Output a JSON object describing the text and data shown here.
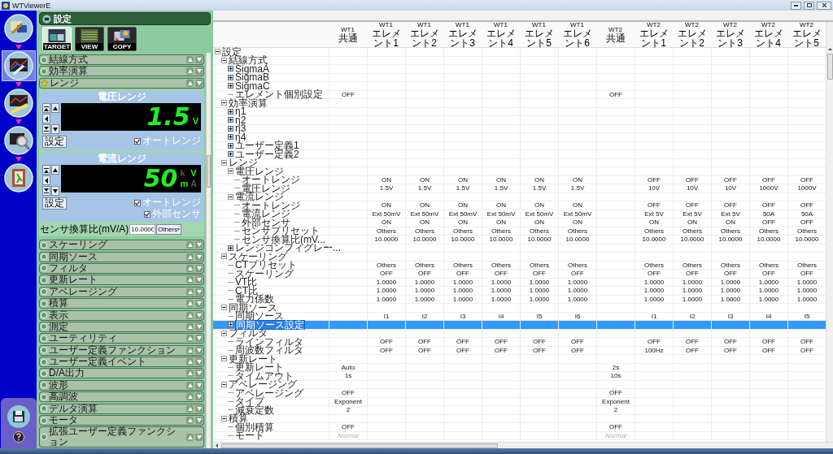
{
  "window": {
    "title": "WTViewerE"
  },
  "rail": {
    "items": [
      {
        "kind": "tools",
        "selected": false
      },
      {
        "kind": "wrench-chart",
        "selected": true
      },
      {
        "kind": "ruler-chart",
        "selected": false
      },
      {
        "kind": "magnifier",
        "selected": false
      },
      {
        "kind": "exit",
        "selected": false
      }
    ],
    "bottom": [
      {
        "kind": "save"
      },
      {
        "kind": "help"
      }
    ]
  },
  "left_panel": {
    "title": "設定",
    "toolbar": [
      {
        "label": "TARGET",
        "kind": "target",
        "selected": true
      },
      {
        "label": "VIEW",
        "kind": "view",
        "selected": false
      },
      {
        "label": "COPY",
        "kind": "copy",
        "selected": false
      }
    ],
    "sections": [
      {
        "label": "結線方式",
        "expanded": false
      },
      {
        "label": "効率演算",
        "expanded": false
      },
      {
        "label": "レンジ",
        "expanded": true,
        "panels": [
          {
            "title": "電圧レンジ",
            "display": "1.5",
            "units": [
              {
                "text": "V",
                "lit": true
              }
            ],
            "button": "設定",
            "checks": [
              {
                "label": "オートレンジ",
                "checked": true
              }
            ]
          },
          {
            "title": "電流レンジ",
            "display": "50",
            "units": [
              {
                "text": "k",
                "lit": false
              },
              {
                "text": "V",
                "lit": true
              },
              {
                "text": "m",
                "lit": true
              },
              {
                "text": "A",
                "lit": false
              }
            ],
            "button": "設定",
            "checks": [
              {
                "label": "オートレンジ",
                "checked": true
              },
              {
                "label": "外部センサ",
                "checked": true
              }
            ]
          }
        ],
        "sensor": {
          "label": "センサ換算比(mV/A)",
          "value": "10.0000",
          "preset": "Others"
        }
      },
      {
        "label": "スケーリング",
        "expanded": false
      },
      {
        "label": "同期ソース",
        "expanded": false
      },
      {
        "label": "フィルタ",
        "expanded": false
      },
      {
        "label": "更新レート",
        "expanded": false
      },
      {
        "label": "アベレージング",
        "expanded": false
      },
      {
        "label": "積算",
        "expanded": false
      },
      {
        "label": "表示",
        "expanded": false
      },
      {
        "label": "測定",
        "expanded": false
      },
      {
        "label": "ユーティリティ",
        "expanded": false
      },
      {
        "label": "ユーザー定義ファンクション",
        "expanded": false
      },
      {
        "label": "ユーザー定義イベント",
        "expanded": false
      },
      {
        "label": "D/A出力",
        "expanded": false
      },
      {
        "label": "波形",
        "expanded": false
      },
      {
        "label": "高調波",
        "expanded": false
      },
      {
        "label": "デルタ演算",
        "expanded": false
      },
      {
        "label": "モータ",
        "expanded": false
      },
      {
        "label": "拡張ユーザー定義ファンクション",
        "expanded": false
      }
    ]
  },
  "table": {
    "columns": [
      {
        "unit": "WT1",
        "name": "共通"
      },
      {
        "unit": "WT1",
        "name": "エレメント1"
      },
      {
        "unit": "WT1",
        "name": "エレメント2"
      },
      {
        "unit": "WT1",
        "name": "エレメント3"
      },
      {
        "unit": "WT1",
        "name": "エレメント4"
      },
      {
        "unit": "WT1",
        "name": "エレメント5"
      },
      {
        "unit": "WT1",
        "name": "エレメント6"
      },
      {
        "unit": "WT2",
        "name": "共通"
      },
      {
        "unit": "WT2",
        "name": "エレメント1"
      },
      {
        "unit": "WT2",
        "name": "エレメント2"
      },
      {
        "unit": "WT2",
        "name": "エレメント3"
      },
      {
        "unit": "WT2",
        "name": "エレメント4"
      },
      {
        "unit": "WT2",
        "name": "エレメント5"
      }
    ],
    "tree": [
      {
        "label": "設定",
        "kind": "folder",
        "expanded": true,
        "selected": false,
        "children": [
          {
            "label": "結線方式",
            "kind": "folder",
            "expanded": true,
            "selected": false,
            "children": [
              {
                "label": "SigmaA",
                "kind": "folder",
                "expanded": false,
                "selected": false
              },
              {
                "label": "SigmaB",
                "kind": "folder",
                "expanded": false,
                "selected": false
              },
              {
                "label": "SigmaC",
                "kind": "folder",
                "expanded": false,
                "selected": false
              },
              {
                "label": "エレメント個別設定",
                "kind": "leaf",
                "selected": false,
                "disabled": false,
                "cells": [
                  "OFF",
                  null,
                  null,
                  null,
                  null,
                  null,
                  null,
                  "OFF",
                  null,
                  null,
                  null,
                  null,
                  null
                ]
              }
            ]
          },
          {
            "label": "効率演算",
            "kind": "folder",
            "expanded": true,
            "selected": false,
            "children": [
              {
                "label": "η1",
                "kind": "folder",
                "expanded": false,
                "selected": false
              },
              {
                "label": "η2",
                "kind": "folder",
                "expanded": false,
                "selected": false
              },
              {
                "label": "η3",
                "kind": "folder",
                "expanded": false,
                "selected": false
              },
              {
                "label": "η4",
                "kind": "folder",
                "expanded": false,
                "selected": false
              },
              {
                "label": "ユーザー定義1",
                "kind": "folder",
                "expanded": false,
                "selected": false
              },
              {
                "label": "ユーザー定義2",
                "kind": "folder",
                "expanded": false,
                "selected": false
              }
            ]
          },
          {
            "label": "レンジ",
            "kind": "folder",
            "expanded": true,
            "selected": false,
            "children": [
              {
                "label": "電圧レンジ",
                "kind": "folder",
                "expanded": true,
                "selected": false,
                "children": [
                  {
                    "label": "オートレンジ",
                    "kind": "leaf",
                    "selected": false,
                    "disabled": false,
                    "cells": [
                      null,
                      "ON",
                      "ON",
                      "ON",
                      "ON",
                      "ON",
                      "ON",
                      null,
                      "OFF",
                      "OFF",
                      "OFF",
                      "OFF",
                      "OFF"
                    ]
                  },
                  {
                    "label": "電圧レンジ",
                    "kind": "leaf",
                    "selected": false,
                    "disabled": false,
                    "cells": [
                      null,
                      "1.5V",
                      "1.5V",
                      "1.5V",
                      "1.5V",
                      "1.5V",
                      "1.5V",
                      null,
                      "10V",
                      "10V",
                      "10V",
                      "1000V",
                      "1000V"
                    ]
                  }
                ]
              },
              {
                "label": "電流レンジ",
                "kind": "folder",
                "expanded": true,
                "selected": false,
                "children": [
                  {
                    "label": "オートレンジ",
                    "kind": "leaf",
                    "selected": false,
                    "disabled": false,
                    "cells": [
                      null,
                      "ON",
                      "ON",
                      "ON",
                      "ON",
                      "ON",
                      "ON",
                      null,
                      "OFF",
                      "OFF",
                      "OFF",
                      "OFF",
                      "OFF"
                    ]
                  },
                  {
                    "label": "電流レンジ",
                    "kind": "leaf",
                    "selected": false,
                    "disabled": false,
                    "cells": [
                      null,
                      "Ext 50mV",
                      "Ext 50mV",
                      "Ext 50mV",
                      "Ext 50mV",
                      "Ext 50mV",
                      "Ext 50mV",
                      null,
                      "Ext 5V",
                      "Ext 5V",
                      "Ext 5V",
                      "50A",
                      "50A"
                    ]
                  },
                  {
                    "label": "外部センサ",
                    "kind": "leaf",
                    "selected": false,
                    "disabled": false,
                    "cells": [
                      null,
                      "ON",
                      "ON",
                      "ON",
                      "ON",
                      "ON",
                      "ON",
                      null,
                      "ON",
                      "ON",
                      "ON",
                      "OFF",
                      "OFF"
                    ]
                  },
                  {
                    "label": "センサプリセット",
                    "kind": "leaf",
                    "selected": false,
                    "disabled": false,
                    "cells": [
                      null,
                      "Others",
                      "Others",
                      "Others",
                      "Others",
                      "Others",
                      "Others",
                      null,
                      "Others",
                      "Others",
                      "Others",
                      "Others",
                      "Others"
                    ]
                  },
                  {
                    "label": "センサ換算比(mV...",
                    "kind": "leaf",
                    "selected": false,
                    "disabled": false,
                    "cells": [
                      null,
                      "10.0000",
                      "10.0000",
                      "10.0000",
                      "10.0000",
                      "10.0000",
                      "10.0000",
                      null,
                      "10.0000",
                      "10.0000",
                      "10.0000",
                      "10.0000",
                      "10.0000"
                    ]
                  }
                ]
              },
              {
                "label": "レンジコンフィグレー...",
                "kind": "folder",
                "expanded": false,
                "selected": false
              }
            ]
          },
          {
            "label": "スケーリング",
            "kind": "folder",
            "expanded": true,
            "selected": false,
            "children": [
              {
                "label": "CTプリセット",
                "kind": "leaf",
                "selected": false,
                "disabled": false,
                "cells": [
                  null,
                  "Others",
                  "Others",
                  "Others",
                  "Others",
                  "Others",
                  "Others",
                  null,
                  "Others",
                  "Others",
                  "Others",
                  "Others",
                  "Others"
                ]
              },
              {
                "label": "スケーリング",
                "kind": "leaf",
                "selected": false,
                "disabled": false,
                "cells": [
                  null,
                  "OFF",
                  "OFF",
                  "OFF",
                  "OFF",
                  "OFF",
                  "OFF",
                  null,
                  "OFF",
                  "OFF",
                  "OFF",
                  "OFF",
                  "OFF"
                ]
              },
              {
                "label": "VT比",
                "kind": "leaf",
                "selected": false,
                "disabled": false,
                "cells": [
                  null,
                  "1.0000",
                  "1.0000",
                  "1.0000",
                  "1.0000",
                  "1.0000",
                  "1.0000",
                  null,
                  "1.0000",
                  "1.0000",
                  "1.0000",
                  "1.0000",
                  "1.0000"
                ]
              },
              {
                "label": "CT比",
                "kind": "leaf",
                "selected": false,
                "disabled": false,
                "cells": [
                  null,
                  "1.0000",
                  "1.0000",
                  "1.0000",
                  "1.0000",
                  "1.0000",
                  "1.0000",
                  null,
                  "1.0000",
                  "1.0000",
                  "1.0000",
                  "1.0000",
                  "1.0000"
                ]
              },
              {
                "label": "電力係数",
                "kind": "leaf",
                "selected": false,
                "disabled": false,
                "cells": [
                  null,
                  "1.0000",
                  "1.0000",
                  "1.0000",
                  "1.0000",
                  "1.0000",
                  "1.0000",
                  null,
                  "1.0000",
                  "1.0000",
                  "1.0000",
                  "1.0000",
                  "1.0000"
                ]
              }
            ]
          },
          {
            "label": "同期ソース",
            "kind": "folder",
            "expanded": true,
            "selected": false,
            "children": [
              {
                "label": "同期ソース",
                "kind": "leaf",
                "selected": false,
                "disabled": false,
                "cells": [
                  null,
                  "I1",
                  "I2",
                  "I3",
                  "I4",
                  "I5",
                  "I6",
                  null,
                  "I1",
                  "I2",
                  "I3",
                  "I4",
                  "I5"
                ]
              },
              {
                "label": "同期ソース設定",
                "kind": "folder",
                "expanded": false,
                "selected": true
              }
            ]
          },
          {
            "label": "フィルタ",
            "kind": "folder",
            "expanded": true,
            "selected": false,
            "children": [
              {
                "label": "ラインフィルタ",
                "kind": "leaf",
                "selected": false,
                "disabled": false,
                "cells": [
                  null,
                  "OFF",
                  "OFF",
                  "OFF",
                  "OFF",
                  "OFF",
                  "OFF",
                  null,
                  "OFF",
                  "OFF",
                  "OFF",
                  "OFF",
                  "OFF"
                ]
              },
              {
                "label": "周波数フィルタ",
                "kind": "leaf",
                "selected": false,
                "disabled": false,
                "cells": [
                  null,
                  "OFF",
                  "OFF",
                  "OFF",
                  "OFF",
                  "OFF",
                  "OFF",
                  null,
                  "100Hz",
                  "OFF",
                  "OFF",
                  "OFF",
                  "OFF"
                ]
              }
            ]
          },
          {
            "label": "更新レート",
            "kind": "folder",
            "expanded": true,
            "selected": false,
            "children": [
              {
                "label": "更新レート",
                "kind": "leaf",
                "selected": false,
                "disabled": false,
                "cells": [
                  "Auto",
                  null,
                  null,
                  null,
                  null,
                  null,
                  null,
                  "2s",
                  null,
                  null,
                  null,
                  null,
                  null
                ]
              },
              {
                "label": "タイムアウト",
                "kind": "leaf",
                "selected": false,
                "disabled": false,
                "cells": [
                  "1s",
                  null,
                  null,
                  null,
                  null,
                  null,
                  null,
                  "10s",
                  null,
                  null,
                  null,
                  null,
                  null
                ]
              }
            ]
          },
          {
            "label": "アベレージング",
            "kind": "folder",
            "expanded": true,
            "selected": false,
            "children": [
              {
                "label": "アベレージング",
                "kind": "leaf",
                "selected": false,
                "disabled": false,
                "cells": [
                  "OFF",
                  null,
                  null,
                  null,
                  null,
                  null,
                  null,
                  "OFF",
                  null,
                  null,
                  null,
                  null,
                  null
                ]
              },
              {
                "label": "タイプ",
                "kind": "leaf",
                "selected": false,
                "disabled": false,
                "cells": [
                  "Exponent",
                  null,
                  null,
                  null,
                  null,
                  null,
                  null,
                  "Exponent",
                  null,
                  null,
                  null,
                  null,
                  null
                ]
              },
              {
                "label": "減衰定数",
                "kind": "leaf",
                "selected": false,
                "disabled": false,
                "cells": [
                  "2",
                  null,
                  null,
                  null,
                  null,
                  null,
                  null,
                  "2",
                  null,
                  null,
                  null,
                  null,
                  null
                ]
              }
            ]
          },
          {
            "label": "積算",
            "kind": "folder",
            "expanded": true,
            "selected": false,
            "children": [
              {
                "label": "個別積算",
                "kind": "leaf",
                "selected": false,
                "disabled": false,
                "cells": [
                  "OFF",
                  null,
                  null,
                  null,
                  null,
                  null,
                  null,
                  "OFF",
                  null,
                  null,
                  null,
                  null,
                  null
                ]
              },
              {
                "label": "モード",
                "kind": "leaf",
                "selected": false,
                "disabled": true,
                "cells": [
                  "Normal",
                  null,
                  null,
                  null,
                  null,
                  null,
                  null,
                  "Normal",
                  null,
                  null,
                  null,
                  null,
                  null
                ]
              }
            ]
          }
        ]
      }
    ]
  }
}
